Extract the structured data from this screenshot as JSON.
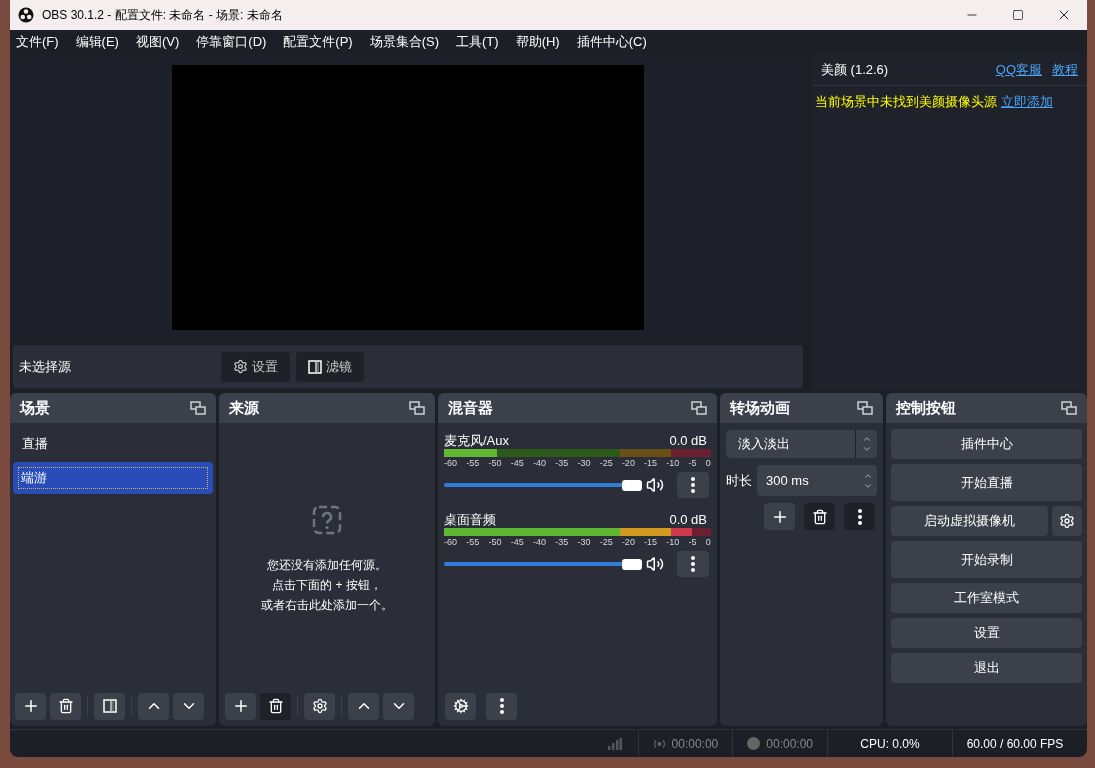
{
  "window": {
    "title": "OBS 30.1.2 - 配置文件: 未命名 - 场景: 未命名"
  },
  "menu": [
    "文件(F)",
    "编辑(E)",
    "视图(V)",
    "停靠窗口(D)",
    "配置文件(P)",
    "场景集合(S)",
    "工具(T)",
    "帮助(H)",
    "插件中心(C)"
  ],
  "plugin_panel": {
    "title": "美颜 (1.2.6)",
    "links": [
      "QQ客服",
      "教程"
    ],
    "warning": "当前场景中未找到美颜摄像头源",
    "action_link": "立即添加"
  },
  "source_bar": {
    "label": "未选择源",
    "buttons": [
      "设置",
      "滤镜"
    ]
  },
  "scenes": {
    "title": "场景",
    "items": [
      {
        "name": "直播",
        "selected": false
      },
      {
        "name": "端游",
        "selected": true
      }
    ]
  },
  "sources": {
    "title": "来源",
    "empty_message": [
      "您还没有添加任何源。",
      "点击下面的 + 按钮，",
      "或者右击此处添加一个。"
    ]
  },
  "mixer": {
    "title": "混音器",
    "channels": [
      {
        "name": "麦克风/Aux",
        "reading": "0.0 dB",
        "meter": {
          "level": 0.2
        },
        "volume": {
          "level": 1
        },
        "ticks": [
          "-60",
          "-55",
          "-50",
          "-45",
          "-40",
          "-35",
          "-30",
          "-25",
          "-20",
          "-15",
          "-10",
          "-5",
          "0"
        ]
      },
      {
        "name": "桌面音频",
        "reading": "0.0 dB",
        "meter": {
          "level": 0.93
        },
        "volume": {
          "level": 1
        },
        "ticks": [
          "-60",
          "-55",
          "-50",
          "-45",
          "-40",
          "-35",
          "-30",
          "-25",
          "-20",
          "-15",
          "-10",
          "-5",
          "0"
        ]
      }
    ]
  },
  "transitions": {
    "title": "转场动画",
    "transition": "淡入淡出",
    "duration_label": "时长",
    "duration": "300 ms"
  },
  "controls": {
    "title": "控制按钮",
    "buttons": [
      {
        "label": "插件中心",
        "settings": false
      },
      {
        "label": "开始直播",
        "settings": false
      },
      {
        "label": "启动虚拟摄像机",
        "settings": true
      },
      {
        "label": "开始录制",
        "settings": false
      },
      {
        "label": "工作室模式",
        "settings": false
      },
      {
        "label": "设置",
        "settings": false
      },
      {
        "label": "退出",
        "settings": false
      }
    ]
  },
  "status_bar": {
    "live_time": "00:00:00",
    "rec_time": "00:00:00",
    "cpu": "CPU: 0.0%",
    "fps": "60.00 / 60.00 FPS"
  }
}
